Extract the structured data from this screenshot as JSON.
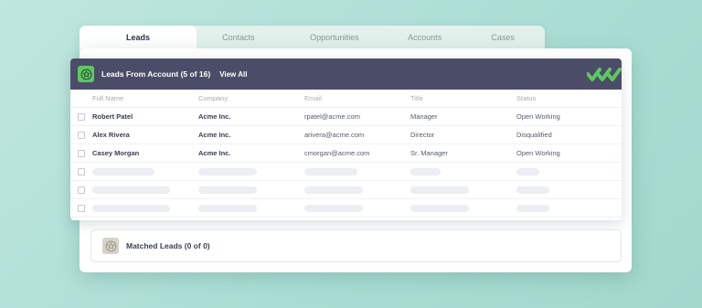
{
  "tabs": [
    {
      "label": "Leads",
      "active": true
    },
    {
      "label": "Contacts",
      "active": false
    },
    {
      "label": "Opportunities",
      "active": false
    },
    {
      "label": "Accounts",
      "active": false
    },
    {
      "label": "Cases",
      "active": false
    }
  ],
  "leads_panel": {
    "title": "Leads From Account (5 of 16)",
    "view_all_label": "View All",
    "icon": "star-person-icon",
    "brand_icon": "checkmarks-logo-icon",
    "accent_color": "#5ec763",
    "header_color": "#4b4d68"
  },
  "columns": [
    "Full Name",
    "Company",
    "Email",
    "Title",
    "Status"
  ],
  "rows": [
    {
      "name": "Robert Patel",
      "company": "Acme Inc.",
      "email": "rpatel@acme.com",
      "title": "Manager",
      "status": "Open Working"
    },
    {
      "name": "Alex Rivera",
      "company": "Acme Inc.",
      "email": "arivera@acme.com",
      "title": "Director",
      "status": "Disqualified"
    },
    {
      "name": "Casey Morgan",
      "company": "Acme Inc.",
      "email": "cmorgan@acme.com",
      "title": "Sr. Manager",
      "status": "Open Working"
    }
  ],
  "placeholder_rows": 3,
  "matched_panel": {
    "title": "Matched Leads (0 of 0)",
    "icon": "star-person-icon"
  }
}
